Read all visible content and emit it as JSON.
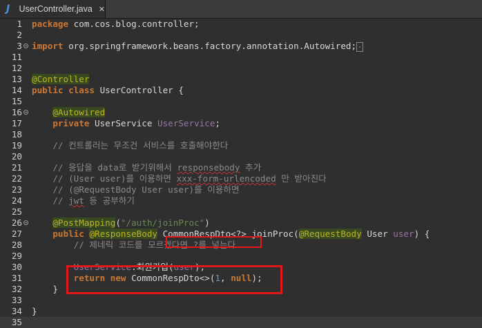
{
  "tab": {
    "label": "UserController.java",
    "close": "✕",
    "icon": "J"
  },
  "lines": [
    {
      "n": "1",
      "html": "<span class='kw'>package</span> com.cos.blog.controller;"
    },
    {
      "n": "2",
      "html": ""
    },
    {
      "n": "3",
      "fold": true,
      "html": "<span class='kw'>import</span> org.springframework.beans.factory.annotation.Autowired;<span class='ellipsis'>.</span>"
    },
    {
      "n": "11",
      "html": ""
    },
    {
      "n": "12",
      "html": ""
    },
    {
      "n": "13",
      "html": "<span class='ann'>@Controller</span>"
    },
    {
      "n": "14",
      "html": "<span class='kw'>public</span> <span class='kw'>class</span> UserController {"
    },
    {
      "n": "15",
      "html": ""
    },
    {
      "n": "16",
      "fold": true,
      "html": "    <span class='ann'>@Autowired</span>"
    },
    {
      "n": "17",
      "html": "    <span class='kw'>private</span> UserService <span class='fld'>UserService</span>;"
    },
    {
      "n": "18",
      "html": ""
    },
    {
      "n": "19",
      "html": "    <span class='cm'>// 컨트롤러는 무조건 서비스를 호출해야한다</span>"
    },
    {
      "n": "20",
      "html": ""
    },
    {
      "n": "21",
      "html": "    <span class='cm'>// 응답을 data로 받기위해서 <span class='squiggle'>responsebody</span> 추가</span>"
    },
    {
      "n": "22",
      "html": "    <span class='cm'>// (User user)를 이용하면 <span class='squiggle'>xxx-form-urlencoded</span> 만 받아진다</span>"
    },
    {
      "n": "23",
      "html": "    <span class='cm'>// (@RequestBody User user)를 이용하면</span>"
    },
    {
      "n": "24",
      "html": "    <span class='cm'>// <span class='squiggle'>jwt</span> 등 공부하기</span>"
    },
    {
      "n": "25",
      "html": ""
    },
    {
      "n": "26",
      "fold": true,
      "html": "    <span class='ann'>@PostMapping</span>(<span class='str'>\"/auth/joinProc\"</span>)"
    },
    {
      "n": "27",
      "html": "    <span class='kw'>public</span> <span class='ann'>@ResponseBody</span> CommonRespDto&lt;?&gt; joinProc(<span class='ann'>@RequestBody</span> User <span class='fld'>user</span>) {"
    },
    {
      "n": "28",
      "html": "        <span class='cm'>// 제네릭 코드를 모르겠다면 ?를 넣는다</span>"
    },
    {
      "n": "29",
      "html": ""
    },
    {
      "n": "30",
      "html": "        <span class='fld'>UserService</span>.회원가입(<span class='fld'>user</span>);"
    },
    {
      "n": "31",
      "html": "        <span class='kw'>return</span> <span class='kw'>new</span> CommonRespDto&lt;&gt;(<span class='num'>1</span>, <span class='kw'>null</span>);"
    },
    {
      "n": "32",
      "html": "    }"
    },
    {
      "n": "33",
      "html": ""
    },
    {
      "n": "34",
      "html": "}"
    },
    {
      "n": "35",
      "html": ""
    }
  ]
}
